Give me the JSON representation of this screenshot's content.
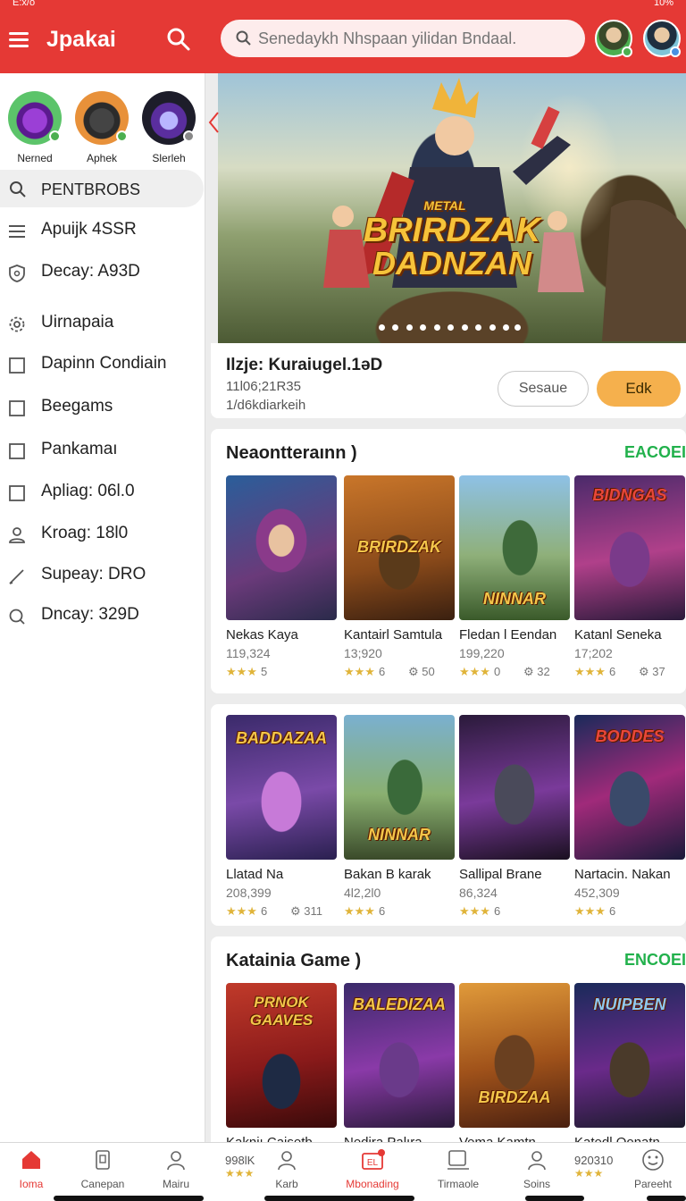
{
  "status": {
    "time": "E:x/o",
    "battery": "10%"
  },
  "header": {
    "app_title": "Jpakai",
    "search_placeholder": "Senedaykh Nhspaan yilidan Bndaal.",
    "colors": {
      "brand": "#e53935",
      "accent": "#f5b04d",
      "link": "#22b14c"
    }
  },
  "sidebar": {
    "favorites": [
      {
        "label": "Nerned",
        "icon": "purple-creature-avatar"
      },
      {
        "label": "Aphek",
        "icon": "armored-warrior-avatar"
      },
      {
        "label": "Slerleh",
        "icon": "dark-knight-avatar"
      }
    ],
    "search_label": "PENTBROBS",
    "items": [
      {
        "label": "Apuijk 4SSR",
        "icon": "list-icon"
      },
      {
        "label": "Decay: A93D",
        "icon": "shield-icon"
      },
      {
        "label": "Uirnapaia",
        "icon": "gear-icon"
      },
      {
        "label": "Dapinn Condiain",
        "icon": "checkbox-icon"
      },
      {
        "label": "Beegams",
        "icon": "checkbox-icon"
      },
      {
        "label": "Pankamaı",
        "icon": "checkbox-icon"
      },
      {
        "label": "Apliag: 06Ɩ.0",
        "icon": "checkbox-icon"
      },
      {
        "label": "Kroag: 18Ɩ0",
        "icon": "user-icon"
      },
      {
        "label": "Supeay: DRO",
        "icon": "pencil-icon"
      },
      {
        "label": "Dncay: 329D",
        "icon": "refresh-search-icon"
      }
    ]
  },
  "banner": {
    "title_small": "METAL",
    "title_line1": "BRIRDZAK",
    "title_line2": "DADNZAN"
  },
  "featured": {
    "title": "Ilzje: Kuraiugel.1əD",
    "subtitle1": "11Ɩ06;21R35",
    "subtitle2": "1/d6kdiarkeih",
    "secondary_button": "Sesaue",
    "primary_button": "Edk"
  },
  "sections": [
    {
      "title": "Neaontteraınn )",
      "more": "EACOEI",
      "games": [
        {
          "name": "Nekas Kaya",
          "count": "119,324",
          "stars": "★★★",
          "rating": "5",
          "extra": "",
          "cover_text": "",
          "cover": "c1"
        },
        {
          "name": "Kantairl Samtula",
          "count": "13;920",
          "stars": "★★★",
          "rating": "6",
          "extra": "⚙ 50",
          "cover_text": "BRIRDZAK",
          "cover": "c2"
        },
        {
          "name": "Fledan l Eendan",
          "count": "199,220",
          "stars": "★★★",
          "rating": "0",
          "extra": "⚙ 32",
          "cover_text": "NINNAR",
          "cover": "c3"
        },
        {
          "name": "Katanl Seneka",
          "count": "17;202",
          "stars": "★★★",
          "rating": "6",
          "extra": "⚙ 37",
          "cover_text": "BIDNGAS",
          "cover": "c4"
        }
      ]
    },
    {
      "title": "",
      "more": "",
      "games": [
        {
          "name": "Llatad Na",
          "count": "208,399",
          "stars": "★★★",
          "rating": "6",
          "extra": "⚙ 311",
          "cover_text": "BADDAZAA",
          "cover": "c5"
        },
        {
          "name": "Bakan B karak",
          "count": "4Ɩ2,2Ɩ0",
          "stars": "★★★",
          "rating": "6",
          "extra": "",
          "cover_text": "NINNAR",
          "cover": "c6"
        },
        {
          "name": "Sallipal Brane",
          "count": "86,324",
          "stars": "★★★",
          "rating": "6",
          "extra": "",
          "cover_text": "",
          "cover": "c7"
        },
        {
          "name": "Nartacin. Nakan",
          "count": "452,309",
          "stars": "★★★",
          "rating": "6",
          "extra": "",
          "cover_text": "BODDES",
          "cover": "c8"
        }
      ]
    },
    {
      "title": "Katainia Game )",
      "more": "ENCOEI",
      "games": [
        {
          "name": "Kakniı Caisetb",
          "count": "",
          "stars": "",
          "rating": "",
          "extra": "",
          "cover_text": "PRNOK GAAVES",
          "cover": "c9"
        },
        {
          "name": "Nedira Palıra",
          "count": "",
          "stars": "",
          "rating": "",
          "extra": "",
          "cover_text": "BALEDIZAA",
          "cover": "c10"
        },
        {
          "name": "Vema Kamtn",
          "count": "",
          "stars": "",
          "rating": "",
          "extra": "",
          "cover_text": "BIRDZAA",
          "cover": "c11"
        },
        {
          "name": "Katedl Qonatn",
          "count": "",
          "stars": "",
          "rating": "",
          "extra": "",
          "cover_text": "NUIPBEN",
          "cover": "c12"
        }
      ]
    }
  ],
  "bottom_nav": {
    "items": [
      {
        "label": "Ioma",
        "icon": "home-icon",
        "active": true
      },
      {
        "label": "Canepan",
        "icon": "tablet-icon",
        "active": false
      },
      {
        "label": "Mairu",
        "icon": "user-icon",
        "active": false
      },
      {
        "label": "Karb",
        "icon": "user-icon",
        "active": false
      },
      {
        "label": "Mbonading",
        "icon": "store-icon",
        "active": true
      },
      {
        "label": "Tirmaole",
        "icon": "device-icon",
        "active": false
      },
      {
        "label": "Soins",
        "icon": "user-icon",
        "active": false
      },
      {
        "label": "Pareeht",
        "icon": "smiley-icon",
        "active": false
      }
    ],
    "extra_left": "998lK",
    "extra_right": "920310",
    "extra_stars": "★★★"
  }
}
